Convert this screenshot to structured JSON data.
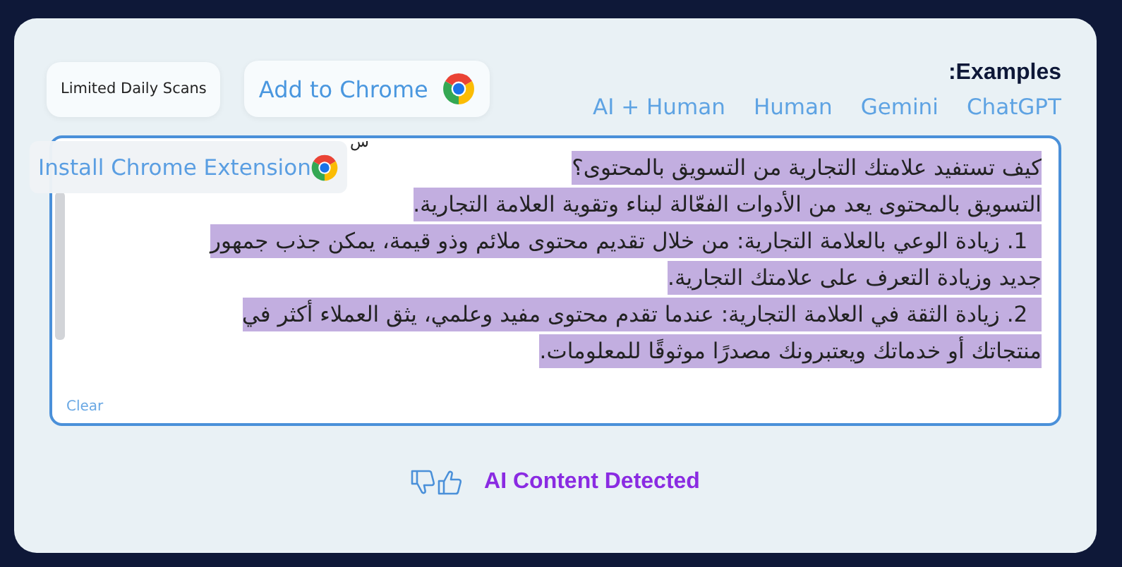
{
  "badges": {
    "scans": "Limited Daily Scans",
    "add_chrome": "Add to Chrome"
  },
  "examples": {
    "title": ":Examples",
    "links": [
      {
        "label": "ChatGPT"
      },
      {
        "label": "Gemini"
      },
      {
        "label": "Human"
      },
      {
        "label": "AI + Human"
      }
    ]
  },
  "editor": {
    "lines": [
      {
        "text": "كيف تستفيد علامتك التجارية من التسويق بالمحتوى؟",
        "highlighted": true
      },
      {
        "text": "التسويق بالمحتوى يعد من الأدوات الفعّالة لبناء وتقوية العلامة التجارية.",
        "highlighted": true
      },
      {
        "text": "  1. زيادة الوعي بالعلامة التجارية: من خلال تقديم محتوى ملائم وذو قيمة، يمكن جذب جمهور",
        "highlighted": true
      },
      {
        "text": "جديد وزيادة التعرف على علامتك التجارية.",
        "highlighted": true
      },
      {
        "text": "  2. زيادة الثقة في العلامة التجارية: عندما تقدم محتوى مفيد وعلمي، يثق العملاء أكثر في",
        "highlighted": true
      },
      {
        "text": "منتجاتك أو خدماتك ويعتبرونك مصدرًا موثوقًا للمعلومات.",
        "highlighted": true
      }
    ],
    "clear": "Clear",
    "overlay": {
      "label": "Install Chrome Extension",
      "mark": "س"
    }
  },
  "result": {
    "label": "AI Content Detected"
  }
}
